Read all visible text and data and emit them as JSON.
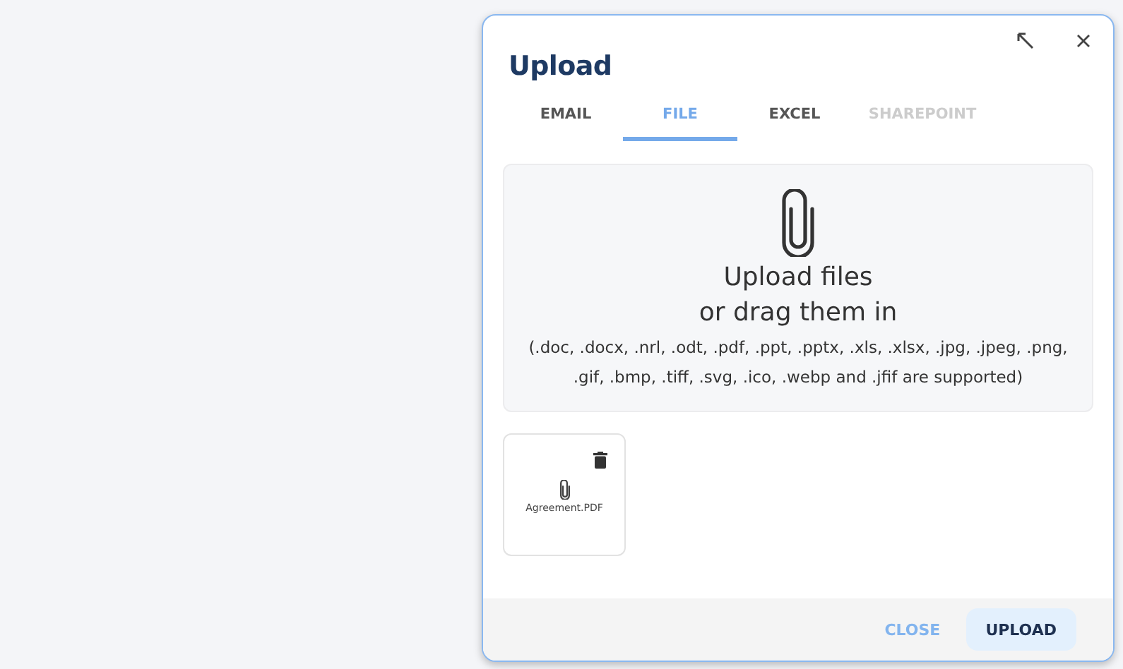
{
  "dialog": {
    "title": "Upload"
  },
  "tabs": [
    {
      "label": "EMAIL",
      "selected": false,
      "disabled": false
    },
    {
      "label": "FILE",
      "selected": true,
      "disabled": false
    },
    {
      "label": "EXCEL",
      "selected": false,
      "disabled": false
    },
    {
      "label": "SHAREPOINT",
      "selected": false,
      "disabled": true
    }
  ],
  "dropzone": {
    "heading_line_1": "Upload files",
    "heading_line_2": "or drag them in",
    "hint": "(.doc, .docx, .nrl, .odt, .pdf, .ppt, .pptx, .xls, .xlsx, .jpg, .jpeg, .png, .gif, .bmp, .tiff, .svg, .ico, .webp and .jfif are supported)"
  },
  "files": [
    {
      "name": "Agreement.PDF"
    }
  ],
  "buttons": [
    {
      "label": "CLOSE",
      "kind": "text"
    },
    {
      "label": "UPLOAD",
      "kind": "filled"
    }
  ]
}
